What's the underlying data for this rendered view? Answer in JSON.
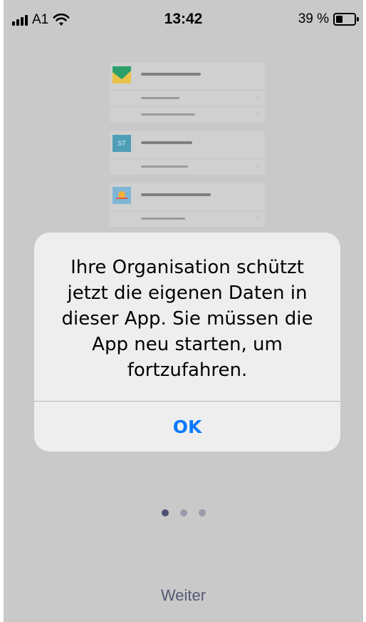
{
  "status_bar": {
    "carrier": "A1",
    "time": "13:42",
    "battery_percent": "39 %",
    "battery_level": 0.39
  },
  "illustration": {
    "items": [
      {
        "icon": "image-app-icon",
        "color": "#2c9e6a",
        "badge": ""
      },
      {
        "icon": "st-app-icon",
        "color": "#4e9fb6",
        "badge": "ST"
      },
      {
        "icon": "weather-app-icon",
        "color": "#f0b23a",
        "badge": ""
      }
    ]
  },
  "alert": {
    "message": "Ihre Organisation schützt jetzt die eigenen Daten in dieser App. Sie müssen die App neu starten, um fortzufahren.",
    "ok_label": "OK"
  },
  "pager": {
    "total": 3,
    "active_index": 0
  },
  "footer": {
    "next_label": "Weiter"
  },
  "colors": {
    "accent": "#0a7aff",
    "background": "#c9c9c9",
    "footer_text": "#555872"
  }
}
